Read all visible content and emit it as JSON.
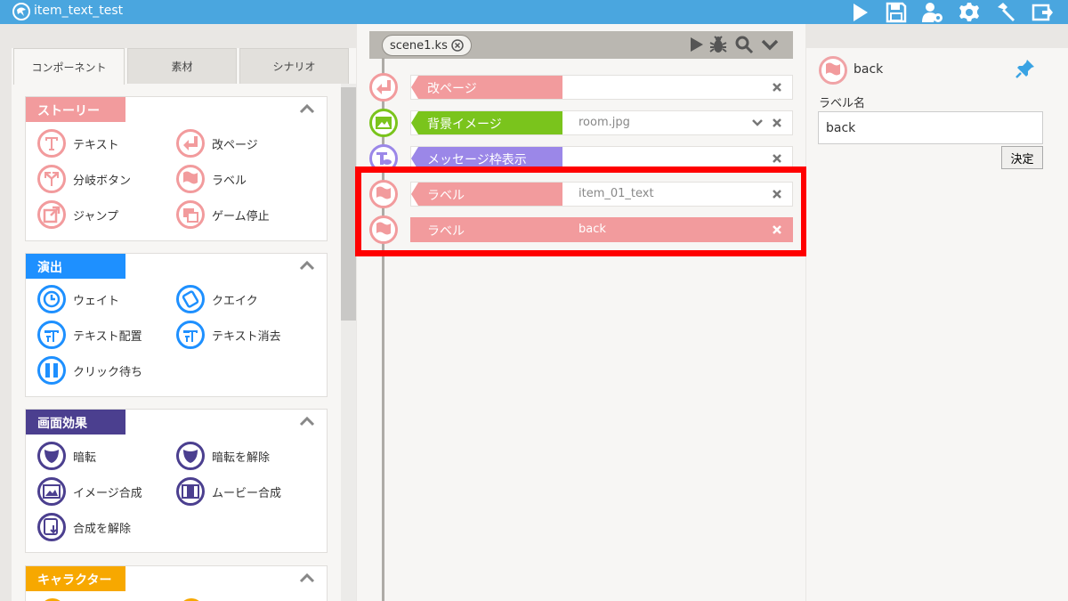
{
  "app": {
    "title": "item_text_test"
  },
  "colors": {
    "titlebar": "#4aa6df",
    "story": "#f29b9d",
    "effect": "#1e90ff",
    "screen": "#4b3f8f",
    "character": "#f7a800",
    "bg_tag": "#7ac41c",
    "msg_tag": "#9b87e8",
    "highlight": "#ff0000"
  },
  "tabs": [
    {
      "label": "コンポーネント"
    },
    {
      "label": "素材"
    },
    {
      "label": "シナリオ"
    }
  ],
  "categories": {
    "story": {
      "label": "ストーリー",
      "items": [
        {
          "label": "テキスト",
          "icon": "text-icon"
        },
        {
          "label": "改ページ",
          "icon": "page-break-icon"
        },
        {
          "label": "分岐ボタン",
          "icon": "branch-icon"
        },
        {
          "label": "ラベル",
          "icon": "flag-icon"
        },
        {
          "label": "ジャンプ",
          "icon": "jump-icon"
        },
        {
          "label": "ゲーム停止",
          "icon": "stop-icon"
        }
      ]
    },
    "effect": {
      "label": "演出",
      "items": [
        {
          "label": "ウェイト",
          "icon": "clock-icon"
        },
        {
          "label": "クエイク",
          "icon": "quake-icon"
        },
        {
          "label": "テキスト配置",
          "icon": "text-place-icon"
        },
        {
          "label": "テキスト消去",
          "icon": "text-erase-icon"
        },
        {
          "label": "クリック待ち",
          "icon": "pause-icon"
        }
      ]
    },
    "screen": {
      "label": "画面効果",
      "items": [
        {
          "label": "暗転",
          "icon": "fade-icon"
        },
        {
          "label": "暗転を解除",
          "icon": "unfade-icon"
        },
        {
          "label": "イメージ合成",
          "icon": "image-icon"
        },
        {
          "label": "ムービー合成",
          "icon": "movie-icon"
        },
        {
          "label": "合成を解除",
          "icon": "uncompose-icon"
        }
      ]
    },
    "character": {
      "label": "キャラクター"
    }
  },
  "editor": {
    "file_tab": "scene1.ks",
    "rows": [
      {
        "tag": "改ページ",
        "param": ""
      },
      {
        "tag": "背景イメージ",
        "param": "room.jpg"
      },
      {
        "tag": "メッセージ枠表示",
        "param": ""
      },
      {
        "tag": "ラベル",
        "param": "item_01_text"
      },
      {
        "tag": "ラベル",
        "param": "back"
      }
    ]
  },
  "props": {
    "title": "back",
    "field_label": "ラベル名",
    "field_value": "back",
    "submit": "決定"
  }
}
